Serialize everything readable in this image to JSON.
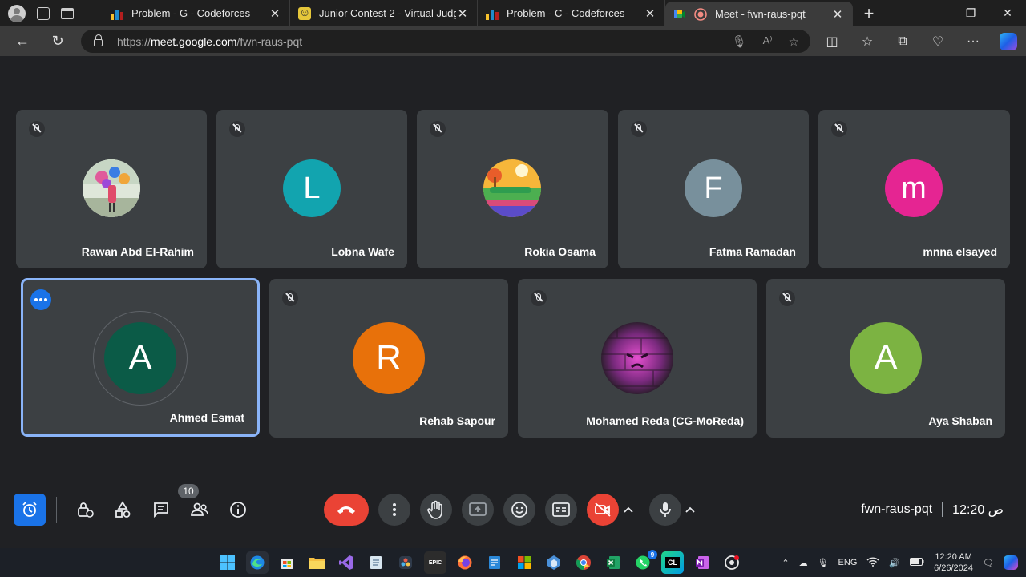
{
  "browser": {
    "tabs": [
      {
        "title": "Problem - G - Codeforces",
        "favicon": "codeforces-icon",
        "active": false
      },
      {
        "title": "Junior Contest 2 - Virtual Judge",
        "favicon": "vjudge-icon",
        "active": false
      },
      {
        "title": "Problem - C - Codeforces",
        "favicon": "codeforces-icon",
        "active": false
      },
      {
        "title": "Meet - fwn-raus-pqt",
        "favicon": "meet-icon",
        "active": true
      }
    ],
    "url_prefix": "https://",
    "url_host": "meet.google.com",
    "url_path": "/fwn-raus-pqt",
    "new_tab_label": "+"
  },
  "participants_row1": [
    {
      "name": "Rawan Abd El-Rahim",
      "avatar_type": "photo",
      "avatar_color": "#c8d8c0"
    },
    {
      "name": "Lobna Wafe",
      "avatar_type": "letter",
      "letter": "L",
      "avatar_color": "#12a4af"
    },
    {
      "name": "Rokia Osama",
      "avatar_type": "illustration",
      "avatar_color": "#f6b63a"
    },
    {
      "name": "Fatma Ramadan",
      "avatar_type": "letter",
      "letter": "F",
      "avatar_color": "#78909c"
    },
    {
      "name": "mnna elsayed",
      "avatar_type": "letter",
      "letter": "m",
      "avatar_color": "#e52592"
    }
  ],
  "participants_row2": [
    {
      "name": "Ahmed Esmat",
      "avatar_type": "letter",
      "letter": "A",
      "avatar_color": "#0b5b47",
      "selected": true
    },
    {
      "name": "Rehab Sapour",
      "avatar_type": "letter",
      "letter": "R",
      "avatar_color": "#e8710a"
    },
    {
      "name": "Mohamed Reda (CG-MoReda)",
      "avatar_type": "photo",
      "avatar_color": "#8a2f86"
    },
    {
      "name": "Aya Shaban",
      "avatar_type": "letter",
      "letter": "A",
      "avatar_color": "#7cb342"
    }
  ],
  "meet": {
    "people_count": "10",
    "meeting_code": "fwn-raus-pqt",
    "time": "12:20 ص"
  },
  "taskbar": {
    "clock_time": "12:20 AM",
    "clock_date": "6/26/2024",
    "language": "ENG",
    "whatsapp_badge": "9",
    "epic_label": "EPIC",
    "clion_label": "CL"
  }
}
